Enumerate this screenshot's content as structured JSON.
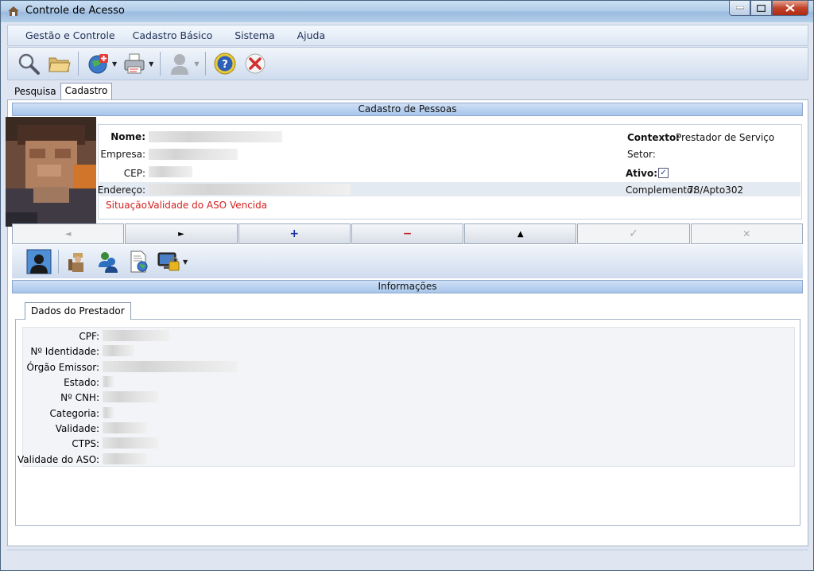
{
  "window": {
    "title": "Controle de Acesso"
  },
  "menu": [
    "Gestão e Controle",
    "Cadastro Básico",
    "Sistema",
    "Ajuda"
  ],
  "toolbar": {
    "icons": [
      "search-icon",
      "folder-icon",
      "globe-add-icon",
      "printer-icon",
      "user-silhouette-icon",
      "help-icon",
      "exit-icon"
    ]
  },
  "tabs": {
    "pesquisa": "Pesquisa",
    "cadastro": "Cadastro"
  },
  "cadastro": {
    "header": "Cadastro de Pessoas",
    "labels": {
      "nome": "Nome:",
      "empresa": "Empresa:",
      "cep": "CEP:",
      "endereco": "Endereço:",
      "situacao": "Situação:",
      "contexto": "Contexto:",
      "setor": "Setor:",
      "ativo": "Ativo:",
      "complemento": "Complemento:"
    },
    "values": {
      "situacao": "Validade do ASO Vencida",
      "contexto": "Prestador de Serviço",
      "complemento": "78/Apto302",
      "ativo_check": "✓"
    }
  },
  "nav": {
    "first": "◄",
    "next": "►",
    "add": "+",
    "remove": "−",
    "up": "▲",
    "confirm": "✓",
    "cancel": "✕"
  },
  "info": {
    "header": "Informações",
    "tab": "Dados do Prestador",
    "labels": [
      "CPF:",
      "Nº Identidade:",
      "Órgão Emissor:",
      "Estado:",
      "Nº CNH:",
      "Categoria:",
      "Validade:",
      "CTPS:",
      "Validade do ASO:"
    ]
  }
}
